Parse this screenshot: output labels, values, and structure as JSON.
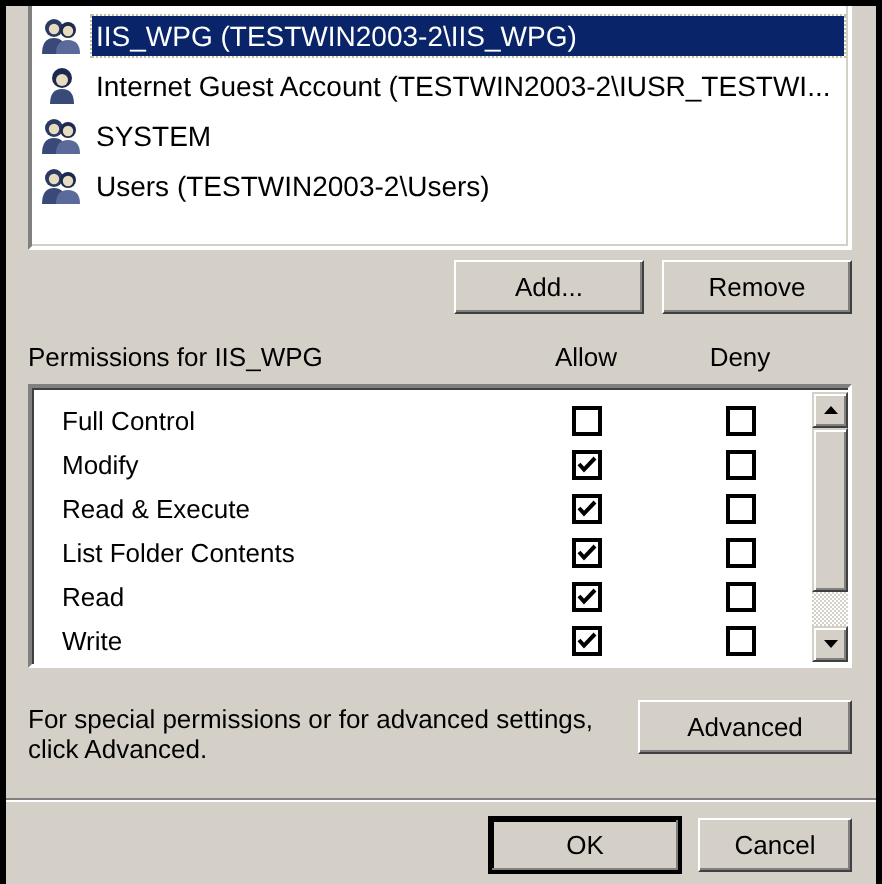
{
  "principals": [
    {
      "name": "IIS_WPG (TESTWIN2003-2\\IIS_WPG)",
      "kind": "group",
      "selected": true
    },
    {
      "name": "Internet Guest Account (TESTWIN2003-2\\IUSR_TESTWI...",
      "kind": "user",
      "selected": false
    },
    {
      "name": "SYSTEM",
      "kind": "group",
      "selected": false
    },
    {
      "name": "Users (TESTWIN2003-2\\Users)",
      "kind": "group",
      "selected": false
    }
  ],
  "list_buttons": [
    "Add...",
    "Remove"
  ],
  "permissions_label": "Permissions for IIS_WPG",
  "columns": [
    "Allow",
    "Deny"
  ],
  "permissions": [
    {
      "name": "Full Control",
      "allow": false,
      "deny": false
    },
    {
      "name": "Modify",
      "allow": true,
      "deny": false
    },
    {
      "name": "Read & Execute",
      "allow": true,
      "deny": false
    },
    {
      "name": "List Folder Contents",
      "allow": true,
      "deny": false
    },
    {
      "name": "Read",
      "allow": true,
      "deny": false
    },
    {
      "name": "Write",
      "allow": true,
      "deny": false
    }
  ],
  "advanced_note": "For special permissions or for advanced settings, click Advanced.",
  "advanced_button": "Advanced",
  "dialog_buttons": [
    {
      "label": "OK",
      "default": true
    },
    {
      "label": "Cancel",
      "default": false
    }
  ]
}
